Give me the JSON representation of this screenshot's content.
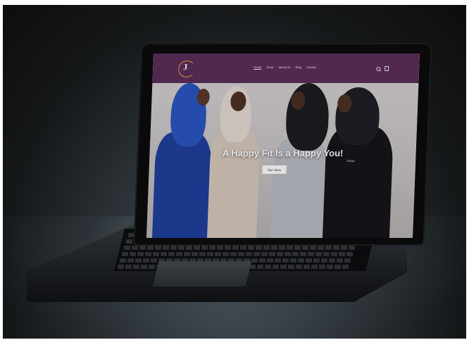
{
  "site": {
    "logo_letter": "J",
    "logo_word": "",
    "nav": [
      {
        "label": "Home",
        "active": true
      },
      {
        "label": "Shop",
        "active": false
      },
      {
        "label": "About Us",
        "active": false
      },
      {
        "label": "Blog",
        "active": false
      },
      {
        "label": "Contact",
        "active": false
      }
    ],
    "header_icons": [
      "search-icon",
      "cart-icon"
    ],
    "colors": {
      "header": "#5c2e59",
      "logo_accent": "#e6a62e",
      "button_bg": "#ffffff"
    }
  },
  "hero": {
    "title": "A Happy Fit Is a Happy You!",
    "button_label": "Our Story",
    "jacket_text": "J'Flow"
  }
}
